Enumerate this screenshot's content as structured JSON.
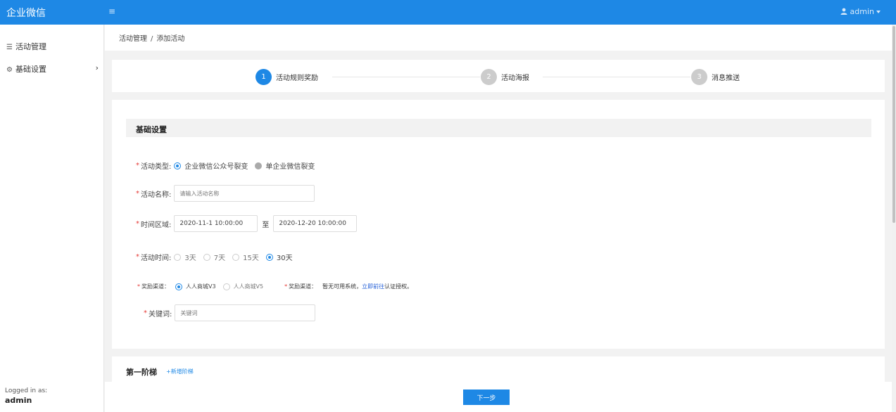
{
  "app": {
    "brand": "企业微信",
    "menu_toggle": "≡",
    "user": "admin"
  },
  "sidebar": {
    "items": [
      {
        "icon": "list-icon",
        "glyph": "☰",
        "label": "活动管理"
      },
      {
        "icon": "gears-icon",
        "glyph": "⚙",
        "label": "基础设置",
        "chevron": "›"
      }
    ],
    "logged_in_label": "Logged in as:",
    "logged_in_user": "admin"
  },
  "breadcrumb": {
    "items": [
      "活动管理",
      "添加活动"
    ],
    "separator": "/"
  },
  "steps": [
    {
      "num": "1",
      "label": "活动规则奖励",
      "active": true
    },
    {
      "num": "2",
      "label": "活动海报",
      "active": false
    },
    {
      "num": "3",
      "label": "消息推送",
      "active": false
    }
  ],
  "form": {
    "section_title": "基础设置",
    "activity_type": {
      "label": "活动类型:",
      "options": [
        "企业微信公众号裂变",
        "单企业微信裂变"
      ],
      "selected": "企业微信公众号裂变"
    },
    "activity_name": {
      "label": "活动名称:",
      "placeholder": "请输入活动名称"
    },
    "time_range": {
      "label": "时间区域:",
      "start": "2020-11-1 10:00:00",
      "to": "至",
      "end": "2020-12-20 10:00:00"
    },
    "activity_duration": {
      "label": "活动时间:",
      "options": [
        "3天",
        "7天",
        "15天",
        "30天"
      ],
      "selected": "30天"
    },
    "reward_channel": {
      "label": "奖励渠道：",
      "options": [
        "人人商城V3",
        "人人商城V5"
      ],
      "selected": "人人商城V3"
    },
    "reward_channel_note": {
      "label": "奖励渠道：",
      "text": "暂无可用系统，",
      "link": "立即前往",
      "suffix": "认证授权。"
    },
    "keyword": {
      "label": "关键词:",
      "placeholder": "关键词"
    }
  },
  "ladder": {
    "title": "第一阶梯",
    "add": "+新增阶梯"
  },
  "footer": {
    "next": "下一步"
  },
  "colors": {
    "primary": "#1e88e5",
    "required": "#e53935",
    "link": "#1e5bd6"
  }
}
